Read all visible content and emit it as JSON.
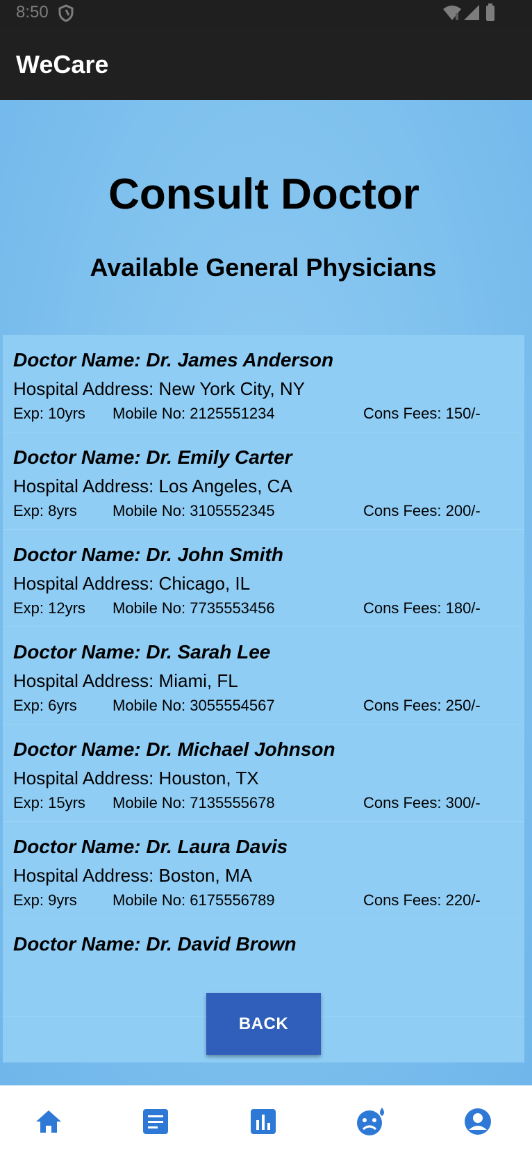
{
  "status_bar": {
    "time": "8:50"
  },
  "app_bar": {
    "title": "WeCare"
  },
  "page": {
    "title": "Consult Doctor",
    "subtitle": "Available General Physicians"
  },
  "doctors": [
    {
      "name": "Doctor Name: Dr. James Anderson",
      "address": "Hospital Address: New York City, NY",
      "exp": "Exp: 10yrs",
      "mobile": "Mobile No: 2125551234",
      "fees": "Cons Fees: 150/-"
    },
    {
      "name": "Doctor Name: Dr. Emily Carter",
      "address": "Hospital Address: Los Angeles, CA",
      "exp": "Exp: 8yrs",
      "mobile": "Mobile No: 3105552345",
      "fees": "Cons Fees: 200/-"
    },
    {
      "name": "Doctor Name: Dr. John Smith",
      "address": "Hospital Address: Chicago, IL",
      "exp": "Exp: 12yrs",
      "mobile": "Mobile No: 7735553456",
      "fees": "Cons Fees: 180/-"
    },
    {
      "name": "Doctor Name: Dr. Sarah Lee",
      "address": "Hospital Address: Miami, FL",
      "exp": "Exp: 6yrs",
      "mobile": "Mobile No: 3055554567",
      "fees": "Cons Fees: 250/-"
    },
    {
      "name": "Doctor Name: Dr. Michael Johnson",
      "address": "Hospital Address: Houston, TX",
      "exp": "Exp: 15yrs",
      "mobile": "Mobile No: 7135555678",
      "fees": "Cons Fees: 300/-"
    },
    {
      "name": "Doctor Name: Dr. Laura Davis",
      "address": "Hospital Address: Boston, MA",
      "exp": "Exp: 9yrs",
      "mobile": "Mobile No: 6175556789",
      "fees": "Cons Fees: 220/-"
    },
    {
      "name": "Doctor Name: Dr. David Brown"
    }
  ],
  "back_button": {
    "label": "BACK"
  },
  "bottom_nav": {
    "items": [
      {
        "icon": "home-icon"
      },
      {
        "icon": "document-icon"
      },
      {
        "icon": "chart-icon"
      },
      {
        "icon": "sad-face-icon"
      },
      {
        "icon": "profile-icon"
      }
    ]
  },
  "colors": {
    "app_bar": "#202020",
    "content_bg": "#7ec0ee",
    "list_bg": "#8fcdf5",
    "button": "#2f5fba",
    "nav_icon": "#2f79d6"
  }
}
